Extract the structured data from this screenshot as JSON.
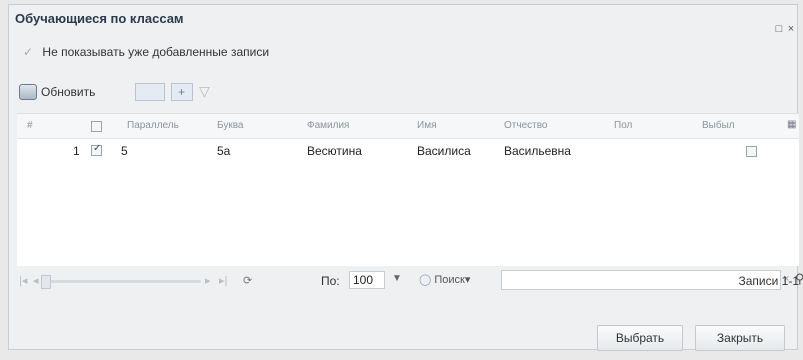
{
  "window": {
    "title": "Обучающиеся по классам",
    "buttons": [
      "□",
      "×"
    ]
  },
  "filter": {
    "checked": false,
    "label": "Не показывать уже добавленные записи"
  },
  "toolbar": {
    "refresh_label": "Обновить"
  },
  "grid": {
    "columns": [
      "#",
      "",
      "Параллель",
      "Буква",
      "Фамилия",
      "Имя",
      "Отчество",
      "Пол",
      "Выбыл"
    ],
    "rows": [
      {
        "num": "1",
        "selected": true,
        "parallel": "5",
        "letter": "5а",
        "surname": "Весютина",
        "name": "Василиса",
        "patronymic": "Васильевна",
        "gender": "",
        "left": false
      }
    ]
  },
  "pager": {
    "per_page_label": "По:",
    "per_page_value": "100",
    "search_label": "Поиск",
    "records_label": "Записи 1-1"
  },
  "footer": {
    "select_label": "Выбрать",
    "close_label": "Закрыть"
  }
}
